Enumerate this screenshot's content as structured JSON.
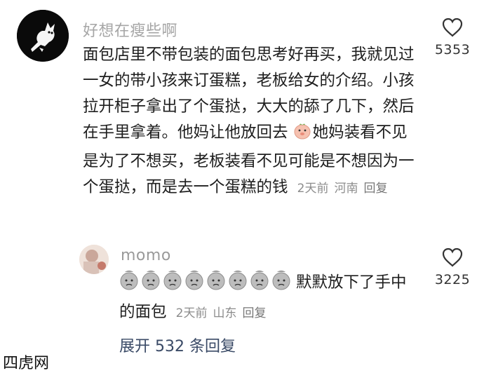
{
  "comments": [
    {
      "username": "好想在瘦些啊",
      "text_before_emoji": "面包店里不带包装的面包思考好再买，我就见过一女的带小孩来订蛋糕，老板给女的介绍。小孩拉开柜子拿出了个蛋挞，大大的舔了几下，然后在手里拿着。他妈让他放回去",
      "text_after_emoji": "她妈装看不见是为了不想买，老板装看不见可能是不想因为一个蛋挞，而是去一个蛋糕的钱",
      "time": "2天前",
      "location": "河南",
      "reply_label": "回复",
      "likes": "5353"
    },
    {
      "username": "momo",
      "text": "默默放下了手中的面包",
      "time": "2天前",
      "location": "山东",
      "reply_label": "回复",
      "likes": "3225"
    }
  ],
  "expand_label": "展开 532 条回复",
  "watermark": "四虎网",
  "icons": [
    "heart-outline-icon",
    "pig-face-emoji",
    "sad-face-emoji"
  ],
  "colors": {
    "username": "#a6a6a6",
    "meta": "#8c8c8c",
    "expand": "#3a4a66"
  }
}
